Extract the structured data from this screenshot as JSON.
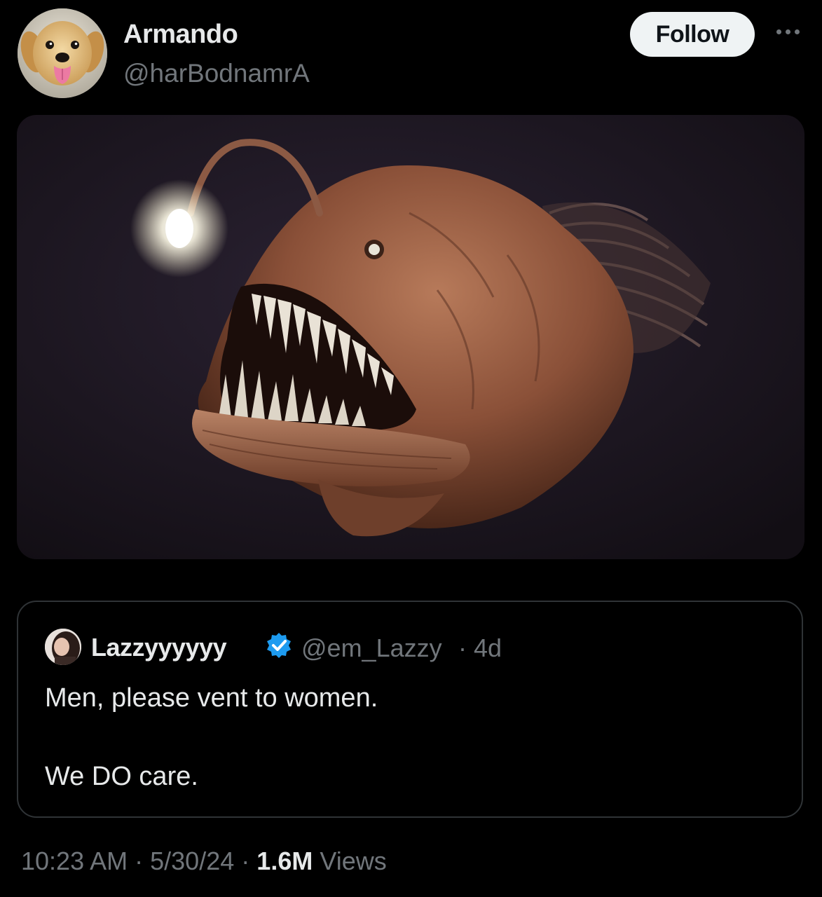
{
  "author": {
    "name": "Armando",
    "handle": "@harBodnamrA",
    "avatar_icon": "puppy-avatar"
  },
  "follow_label": "Follow",
  "more_icon": "ellipsis-icon",
  "media": {
    "description_icon": "anglerfish-image"
  },
  "quote": {
    "name": "Lazzyyyyyy",
    "verified_icon": "verified-badge-icon",
    "verified_color": "#1d9bf0",
    "handle": "@em_Lazzy",
    "separator": "·",
    "time": "4d",
    "line1": "Men, please vent to women.",
    "line2": "We DO care."
  },
  "meta": {
    "time": "10:23 AM",
    "sep1": "·",
    "date": "5/30/24",
    "sep2": "·",
    "views_count": "1.6M",
    "views_label": "Views"
  }
}
